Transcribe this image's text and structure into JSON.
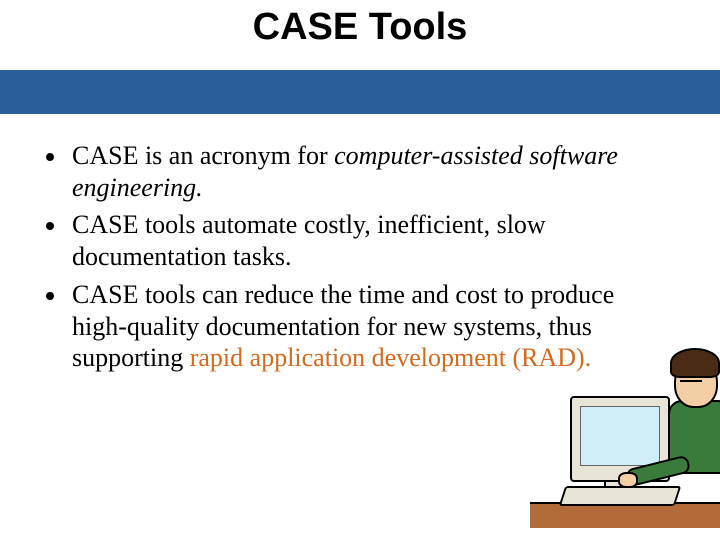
{
  "title": "CASE Tools",
  "bullets": [
    {
      "pre": "CASE is an acronym for ",
      "em": "computer-assisted software engineering.",
      "post": ""
    },
    {
      "pre": "CASE tools automate costly, inefficient, slow documentation tasks.",
      "em": "",
      "post": ""
    },
    {
      "pre": "CASE tools can reduce the time and cost to produce high-quality documentation for new systems, thus supporting ",
      "em": "",
      "highlight": "rapid application development (RAD).",
      "post": ""
    }
  ]
}
